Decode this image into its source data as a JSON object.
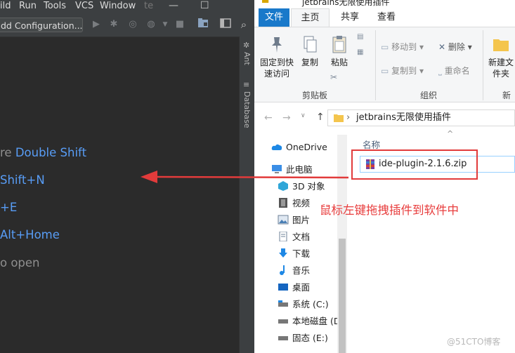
{
  "ide": {
    "menu": [
      "ild",
      "Run",
      "Tools",
      "VCS",
      "Window",
      "te"
    ],
    "window_controls": {
      "minimize": "—",
      "maximize": "☐"
    },
    "run_config": "dd Configuration...",
    "hints": [
      {
        "prefix": "re ",
        "key": "Double Shift"
      },
      {
        "prefix": "",
        "key": "Shift+N"
      },
      {
        "prefix": "",
        "key": "+E"
      },
      {
        "prefix": "",
        "key": "Alt+Home"
      },
      {
        "prefix": "o open",
        "key": ""
      }
    ],
    "side_tabs": [
      "Ant",
      "Database"
    ]
  },
  "explorer": {
    "title": "jetbrains无限使用插件",
    "tabs": [
      "文件",
      "主页",
      "共享",
      "查看"
    ],
    "ribbon": {
      "pin": "固定到快速访问",
      "copy": "复制",
      "paste": "粘贴",
      "move_to": "移动到",
      "copy_to": "复制到",
      "delete": "删除",
      "rename": "重命名",
      "new_folder": "新建文件夹",
      "group_clipboard": "剪贴板",
      "group_organize": "组织",
      "group_new": "新建"
    },
    "address": "jetbrains无限使用插件",
    "nav": [
      "OneDrive",
      "此电脑",
      "3D 对象",
      "视频",
      "图片",
      "文档",
      "下载",
      "音乐",
      "桌面",
      "系统 (C:)",
      "本地磁盘 (D",
      "固态 (E:)"
    ],
    "column_name": "名称",
    "file": "ide-plugin-2.1.6.zip"
  },
  "annotation": "鼠标左键拖拽插件到软件中",
  "watermark": "@51CTO博客",
  "colors": {
    "accent_red": "#e83e3e",
    "ide_bg": "#2b2b2b",
    "key_blue": "#589df6",
    "explorer_file_tab": "#1979ca"
  }
}
